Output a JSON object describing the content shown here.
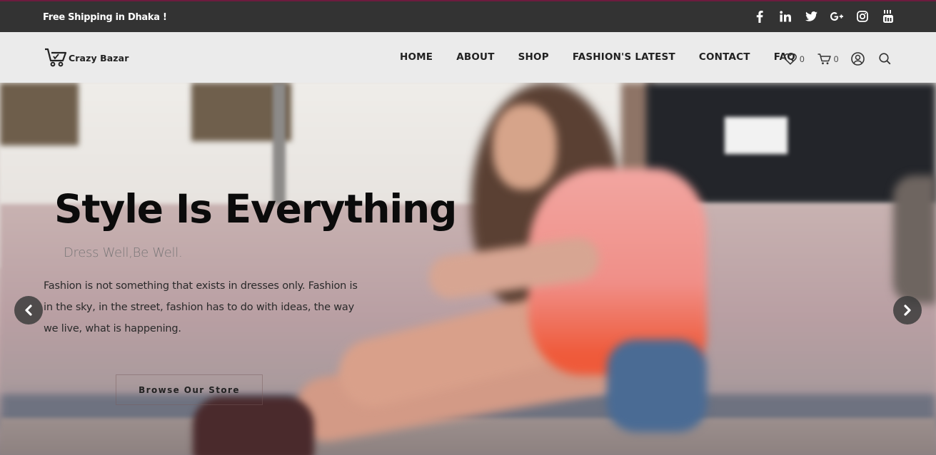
{
  "topbar": {
    "promo": "Free Shipping in Dhaka !",
    "social": [
      "facebook-icon",
      "linkedin-icon",
      "twitter-icon",
      "google-plus-icon",
      "instagram-icon",
      "youtube-icon"
    ]
  },
  "header": {
    "logo_text": "Crazy Bazar",
    "nav": [
      "HOME",
      "ABOUT",
      "SHOP",
      "FASHION'S LATEST",
      "CONTACT",
      "FAQ"
    ],
    "wishlist_count": "0",
    "cart_count": "0"
  },
  "hero": {
    "title": "Style Is Everything",
    "subtitle": "Dress Well,Be Well.",
    "text": "Fashion is not something that exists in dresses only. Fashion is in the sky, in the street, fashion has to do with ideas, the way we live, what is happening.",
    "button": "Browse Our Store"
  },
  "colors": {
    "topbar_bg": "#333333",
    "topbar_accent": "#6d1b3e",
    "header_bg": "#ebebeb"
  }
}
